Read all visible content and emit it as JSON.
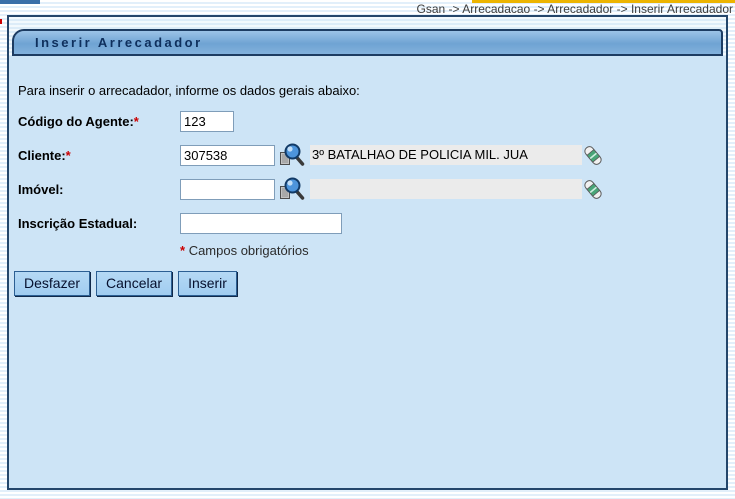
{
  "breadcrumb": {
    "text": "Gsan -> Arrecadacao -> Arrecadador -> Inserir Arrecadador"
  },
  "title_bar": {
    "title": "Inserir Arrecadador"
  },
  "form": {
    "intro": "Para inserir o arrecadador, informe os dados gerais abaixo:",
    "fields": {
      "codigo_agente": {
        "label": "Código do Agente:",
        "required_marker": "*",
        "value": "123"
      },
      "cliente": {
        "label": "Cliente:",
        "required_marker": "*",
        "value": "307538",
        "display_name": "3º BATALHAO DE POLICIA MIL. JUA"
      },
      "imovel": {
        "label": "Imóvel:",
        "value": "",
        "display_name": ""
      },
      "inscricao_estadual": {
        "label": "Inscrição Estadual:",
        "value": ""
      }
    },
    "required_note": {
      "marker": "*",
      "text": "Campos obrigatórios"
    }
  },
  "buttons": {
    "desfazer": "Desfazer",
    "cancelar": "Cancelar",
    "inserir": "Inserir"
  },
  "icons": {
    "search": "magnifier-icon",
    "clear": "eraser-icon"
  },
  "colors": {
    "panel_bg": "#cde4f6",
    "panel_border": "#24466b",
    "title_text": "#0e2f5c",
    "accent_yellow": "#edb400",
    "required_red": "#cc0000",
    "button_bg": "#a9d3f2",
    "readonly_bg": "#ebebeb"
  }
}
